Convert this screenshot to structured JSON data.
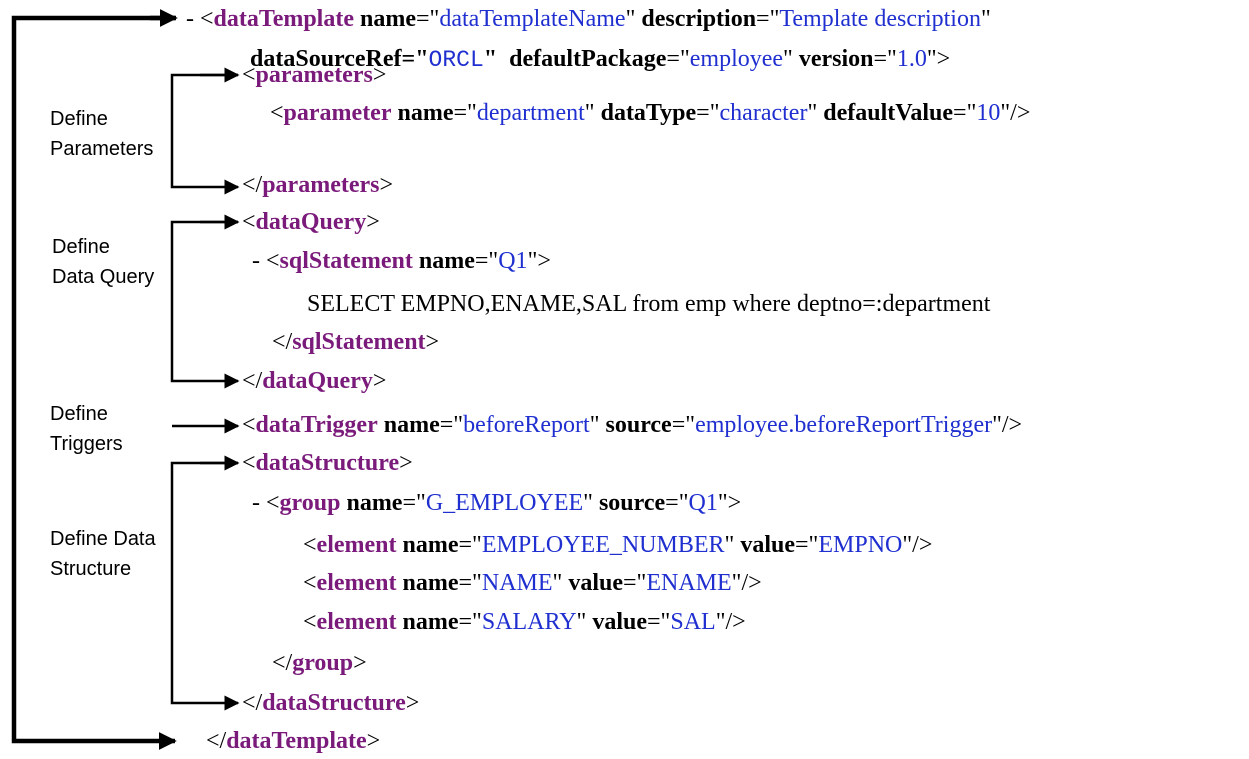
{
  "labels": {
    "define_parameters": [
      "Define",
      "Parameters"
    ],
    "define_data_query": [
      "Define",
      "Data Query"
    ],
    "define_triggers": [
      "Define",
      "Triggers"
    ],
    "define_data_structure": [
      "Define Data",
      "Structure"
    ]
  },
  "xml": {
    "dash": "-",
    "data_template": {
      "tag": "dataTemplate",
      "name_attr": "name",
      "name_val": "dataTemplateName",
      "desc_attr": "description",
      "desc_val": "Template description",
      "source_attr": "dataSourceRef",
      "source_val": "ORCL",
      "pkg_attr": "defaultPackage",
      "pkg_val": "employee",
      "version_attr": "version",
      "version_val": "1.0"
    },
    "parameters_tag": "parameters",
    "parameter": {
      "tag": "parameter",
      "name_attr": "name",
      "name_val": "department",
      "type_attr": "dataType",
      "type_val": "character",
      "default_attr": "defaultValue",
      "default_val": "10"
    },
    "data_query_tag": "dataQuery",
    "sql_statement": {
      "tag": "sqlStatement",
      "name_attr": "name",
      "name_val": "Q1",
      "sql": "SELECT EMPNO,ENAME,SAL from emp where deptno=:department"
    },
    "data_trigger": {
      "tag": "dataTrigger",
      "name_attr": "name",
      "name_val": "beforeReport",
      "source_attr": "source",
      "source_val": "employee.beforeReportTrigger"
    },
    "data_structure_tag": "dataStructure",
    "group": {
      "tag": "group",
      "name_attr": "name",
      "name_val": "G_EMPLOYEE",
      "source_attr": "source",
      "source_val": "Q1"
    },
    "elements": [
      {
        "tag": "element",
        "name_attr": "name",
        "name_val": "EMPLOYEE_NUMBER",
        "value_attr": "value",
        "value_val": "EMPNO"
      },
      {
        "tag": "element",
        "name_attr": "name",
        "name_val": "NAME",
        "value_attr": "value",
        "value_val": "ENAME"
      },
      {
        "tag": "element",
        "name_attr": "name",
        "name_val": "SALARY",
        "value_attr": "value",
        "value_val": "SAL"
      }
    ]
  }
}
